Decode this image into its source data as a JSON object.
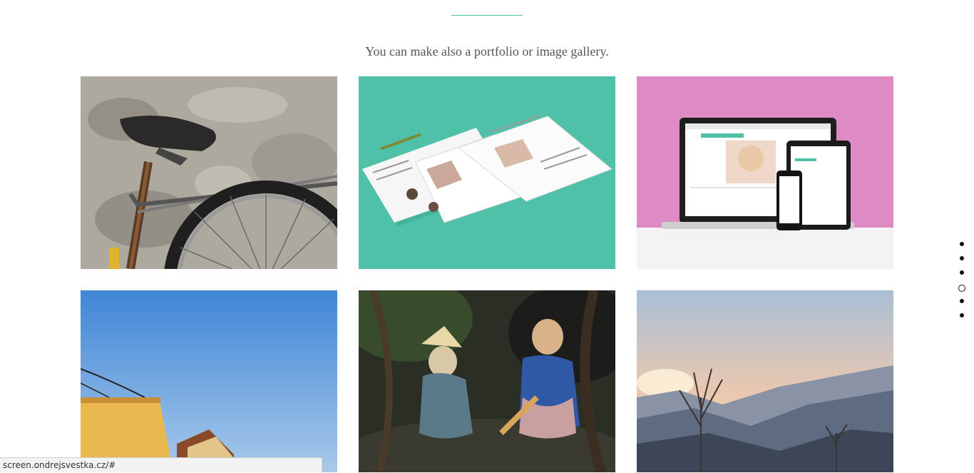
{
  "section": {
    "subtitle": "You can make also a portfolio or image gallery."
  },
  "gallery": {
    "items": [
      {
        "subject": "bicycle seat against a weathered wall"
      },
      {
        "subject": "website mockup pages on teal background"
      },
      {
        "subject": "responsive devices mockup on pink background"
      },
      {
        "subject": "yellow building under blue sky"
      },
      {
        "subject": "ceramic figurines on a tree root"
      },
      {
        "subject": "misty mountain landscape at sunset"
      }
    ]
  },
  "pager": {
    "count": 6,
    "active_index": 3
  },
  "status_bar": {
    "url": "screen.ondrejsvestka.cz/#"
  },
  "colors": {
    "accent": "#54c2ab",
    "teal_tile": "#4fc1a8",
    "pink_tile": "#de8ac4",
    "sky_blue": "#6b9fd6"
  }
}
